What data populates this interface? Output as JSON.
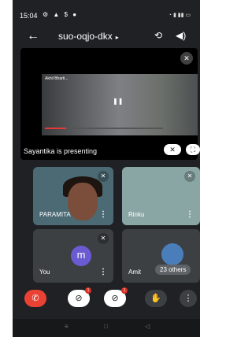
{
  "status_bar": {
    "time": "15:04"
  },
  "meeting": {
    "code": "suo-oqjo-dkx"
  },
  "presentation": {
    "label": "Sayantika is presenting",
    "inner_video_title": "Akhil Bharti..."
  },
  "participants": [
    {
      "name": "PARAMITA"
    },
    {
      "name": "Rinku"
    },
    {
      "name": "You",
      "avatar_letter": "m"
    },
    {
      "name": "Amit",
      "others_label": "23 others"
    }
  ],
  "controls": {
    "camera_badge": "1",
    "mic_badge": "1"
  },
  "colors": {
    "end_call": "#e94235",
    "avatar_purple": "#6b5bd2",
    "background": "#202124"
  }
}
